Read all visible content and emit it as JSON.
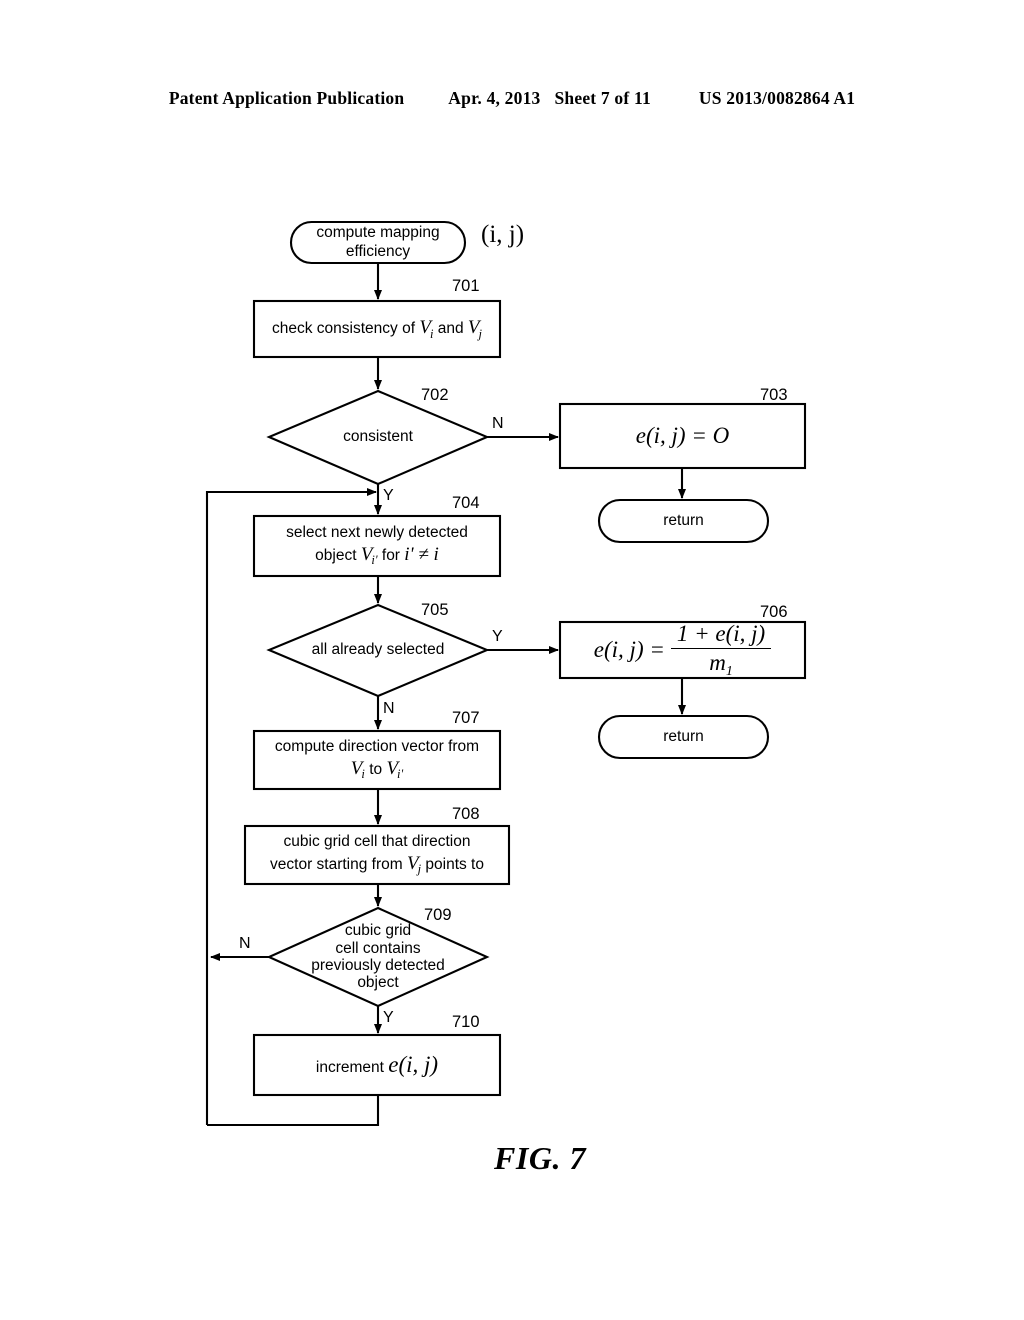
{
  "header": {
    "publication": "Patent Application Publication",
    "date": "Apr. 4, 2013",
    "sheet": "Sheet 7 of 11",
    "patent_number": "US 2013/0082864 A1"
  },
  "figure": {
    "caption": "FIG. 7",
    "argument_label": "(i, j)"
  },
  "nodes": {
    "start": {
      "line1": "compute mapping",
      "line2": "efficiency"
    },
    "n701": {
      "ref": "701",
      "text_pre": "check consistency of ",
      "v_i": "V",
      "sub_i": "i",
      "mid": " and ",
      "v_j": "V",
      "sub_j": "j"
    },
    "n702": {
      "ref": "702",
      "label": "consistent"
    },
    "n703": {
      "ref": "703",
      "formula": "e(i, j) = O"
    },
    "return1": {
      "label": "return"
    },
    "n704": {
      "ref": "704",
      "line1": "select next newly detected",
      "line2_pre": "object ",
      "v": "V",
      "sub": "i'",
      "line2_mid": " for ",
      "cond": "i' ≠ i"
    },
    "n705": {
      "ref": "705",
      "label": "all already selected"
    },
    "n706": {
      "ref": "706",
      "lhs": "e(i, j) =",
      "numerator": "1 + e(i, j)",
      "denominator": "m",
      "den_sub": "1"
    },
    "return2": {
      "label": "return"
    },
    "n707": {
      "ref": "707",
      "line1": "compute direction vector from",
      "v_from": "V",
      "sub_from": "i",
      "to": " to ",
      "v_to": "V",
      "sub_to": "i'"
    },
    "n708": {
      "ref": "708",
      "line1": "cubic grid cell that direction",
      "line2_pre": "vector starting from ",
      "v": "V",
      "sub": "j",
      "line2_post": " points to"
    },
    "n709": {
      "ref": "709",
      "line1": "cubic grid",
      "line2": "cell contains",
      "line3": "previously detected",
      "line4": "object"
    },
    "n710": {
      "ref": "710",
      "text_pre": "increment ",
      "formula": "e(i, j)"
    }
  },
  "branches": {
    "b702_no": "N",
    "b702_yes": "Y",
    "b705_yes": "Y",
    "b705_no": "N",
    "b709_no": "N",
    "b709_yes": "Y"
  },
  "colors": {
    "ink": "#000000",
    "paper": "#ffffff"
  }
}
